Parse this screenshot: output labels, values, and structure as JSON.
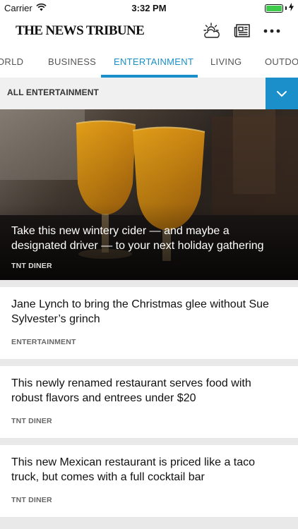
{
  "status": {
    "carrier": "Carrier",
    "time": "3:32 PM",
    "battery_level": 1.0
  },
  "header": {
    "masthead": "THE NEWS TRIBUNE",
    "icons": [
      "weather-icon",
      "eedition-icon",
      "more-icon"
    ]
  },
  "nav": {
    "tabs": [
      {
        "label": "WORLD",
        "visible_text": "ORLD"
      },
      {
        "label": "BUSINESS"
      },
      {
        "label": "ENTERTAINMENT",
        "active": true
      },
      {
        "label": "LIVING"
      },
      {
        "label": "OUTDOO"
      }
    ]
  },
  "section": {
    "label": "ALL ENTERTAINMENT"
  },
  "hero": {
    "title": "Take this new wintery cider — and maybe a designated driver — to your next holiday gathering",
    "kicker": "TNT DINER"
  },
  "articles": [
    {
      "title": "Jane Lynch to bring the Christmas glee without Sue Sylvester’s grinch",
      "kicker": "ENTERTAINMENT"
    },
    {
      "title": "This newly renamed restaurant serves food with robust flavors and entrees under $20",
      "kicker": "TNT DINER"
    },
    {
      "title": "This new Mexican restaurant is priced like a taco truck, but comes with a full cocktail bar",
      "kicker": "TNT DINER"
    }
  ],
  "colors": {
    "accent": "#1a8fc9",
    "battery": "#3ecb4b"
  }
}
